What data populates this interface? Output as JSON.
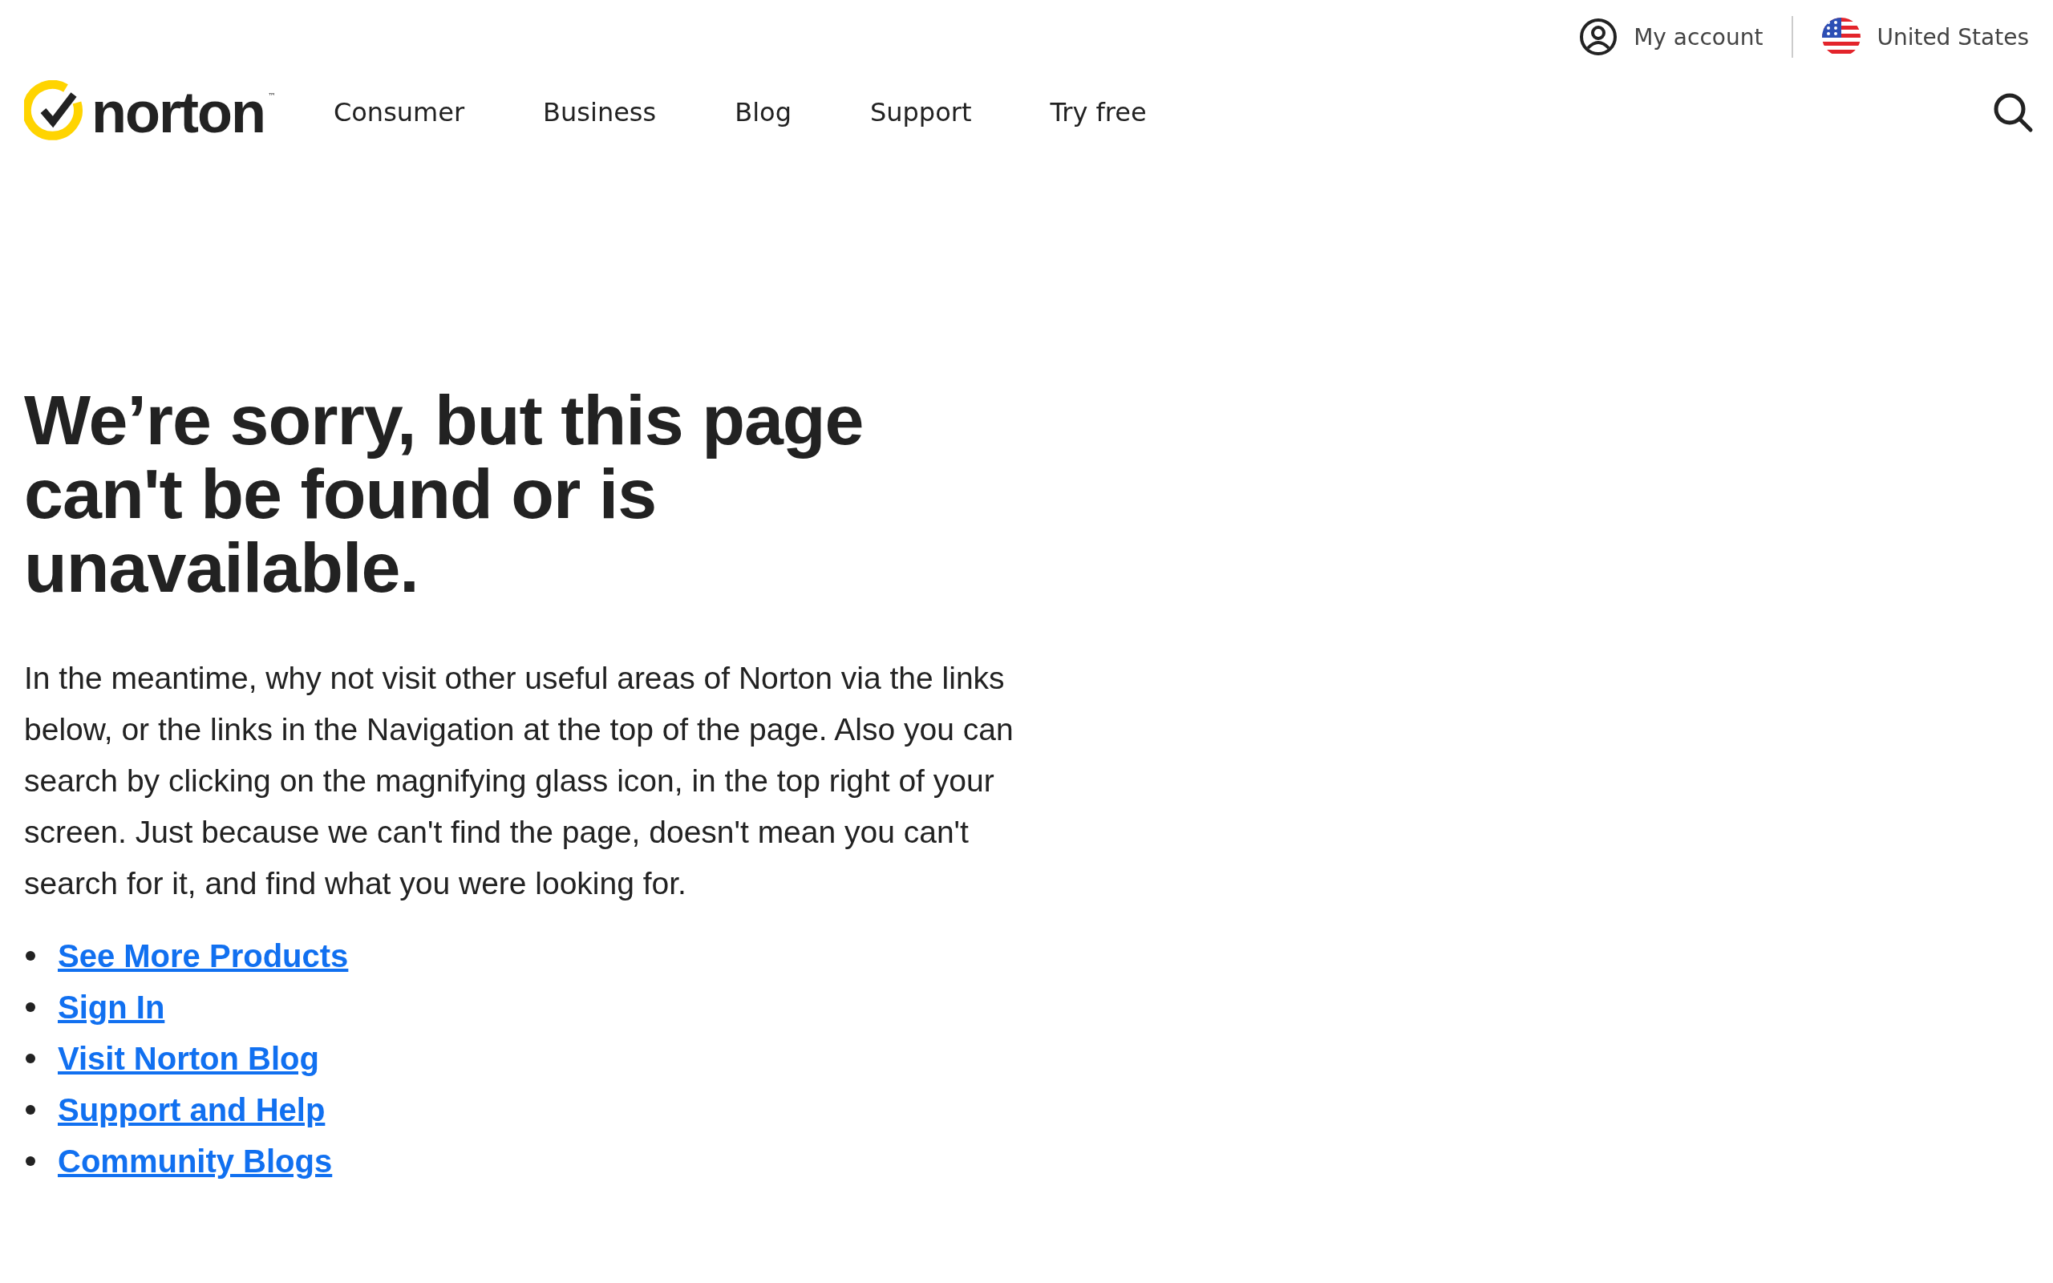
{
  "top_bar": {
    "account": "My account",
    "region": "United States"
  },
  "logo": {
    "word": "norton",
    "mark": "™"
  },
  "nav": [
    "Consumer",
    "Business",
    "Blog",
    "Support",
    "Try free"
  ],
  "heading": "We’re sorry, but this page can't be found or is unavailable.",
  "message": "In the meantime, why not visit other useful areas of Norton via the links below, or the links in the Navigation at the top of the page. Also you can search by clicking on the magnifying glass icon, in the top right of your screen. Just because we can't find the page, doesn't mean you can't search for it, and find what you were looking for.",
  "links": [
    "See More Products",
    "Sign In",
    "Visit Norton Blog",
    "Support and Help",
    "Community Blogs"
  ]
}
